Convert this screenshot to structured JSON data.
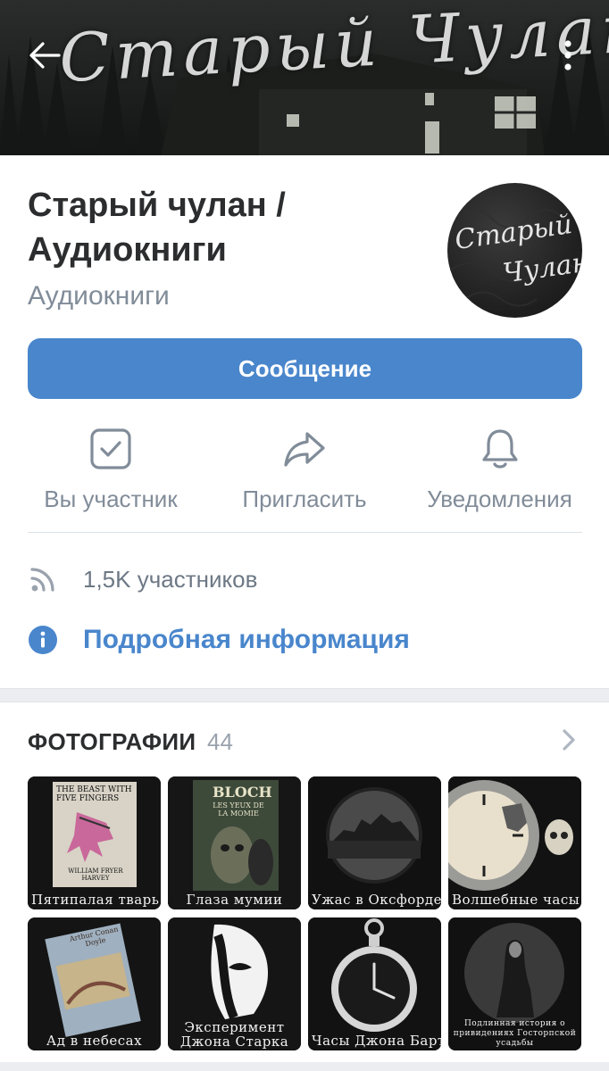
{
  "cover": {
    "title": "Старый Чулан",
    "back_icon": "arrow-left-icon",
    "more_icon": "more-vertical-icon"
  },
  "group": {
    "name": "Старый чулан / Аудиокниги",
    "category": "Аудиокниги",
    "avatar_text_1": "Старый",
    "avatar_text_2": "Чулан"
  },
  "message_button": {
    "label": "Сообщение"
  },
  "actions": [
    {
      "label": "Вы участник",
      "icon": "checkbox-checked-icon"
    },
    {
      "label": "Пригласить",
      "icon": "share-arrow-icon"
    },
    {
      "label": "Уведомления",
      "icon": "bell-icon"
    }
  ],
  "members": {
    "text": "1,5K участников",
    "icon": "rss-icon"
  },
  "details": {
    "label": "Подробная информация",
    "icon": "info-icon"
  },
  "photos": {
    "title": "ФОТОГРАФИИ",
    "count": "44",
    "chevron_icon": "chevron-right-icon",
    "items": [
      {
        "caption": "Пятипалая тварь",
        "book_title": "THE BEAST WITH FIVE FINGERS",
        "book_author": "WILLIAM FRYER HARVEY"
      },
      {
        "caption": "Глаза мумии",
        "book_title": "BLOCH",
        "book_subtitle": "LES YEUX DE LA MOMIE"
      },
      {
        "caption": "Ужас в Оксфорде"
      },
      {
        "caption": "Волшебные часы"
      },
      {
        "caption": "Ад в небесах",
        "book_title": "Arthur Conan Doyle"
      },
      {
        "caption": "Эксперимент Джона Старка"
      },
      {
        "caption": "Часы Джона Бартайн"
      },
      {
        "caption": "Подлинная история о привидениях Госторпской усадьбы"
      }
    ]
  },
  "colors": {
    "accent": "#4986cc",
    "text_primary": "#2c2d2e",
    "text_secondary": "#818c99",
    "separator": "#ebedf0"
  }
}
